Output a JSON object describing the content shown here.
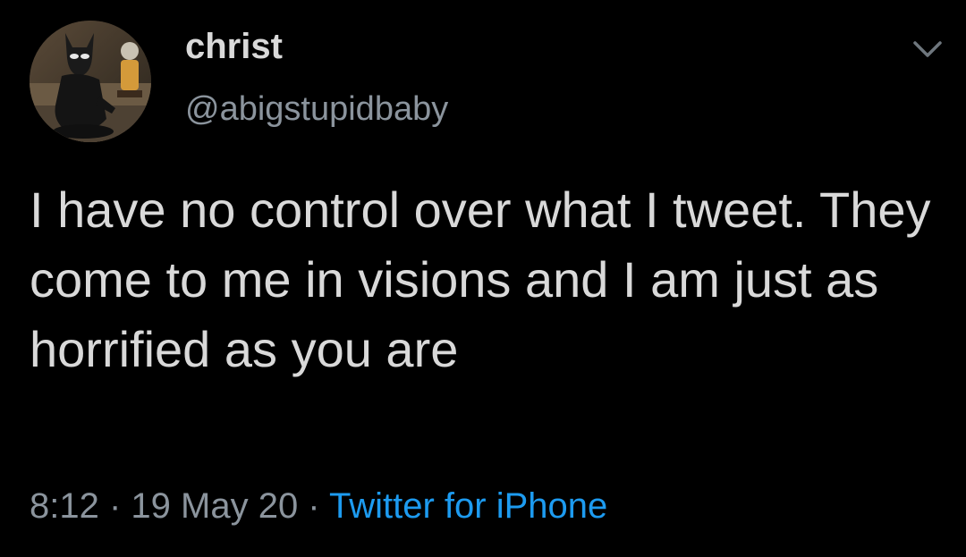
{
  "user": {
    "display_name": "christ",
    "handle": "@abigstupidbaby",
    "avatar_icon": "profile-avatar"
  },
  "menu": {
    "icon": "chevron-down-icon"
  },
  "tweet": {
    "text": "I have no control over what I tweet. They come to me in visions and I am just as horrified as you are"
  },
  "meta": {
    "time": "8:12",
    "sep1": " · ",
    "date": "19 May 20",
    "sep2": " · ",
    "source": "Twitter for iPhone"
  },
  "colors": {
    "background": "#000000",
    "text": "#d9d9d9",
    "secondary": "#8b949d",
    "link": "#1d9bf0"
  }
}
